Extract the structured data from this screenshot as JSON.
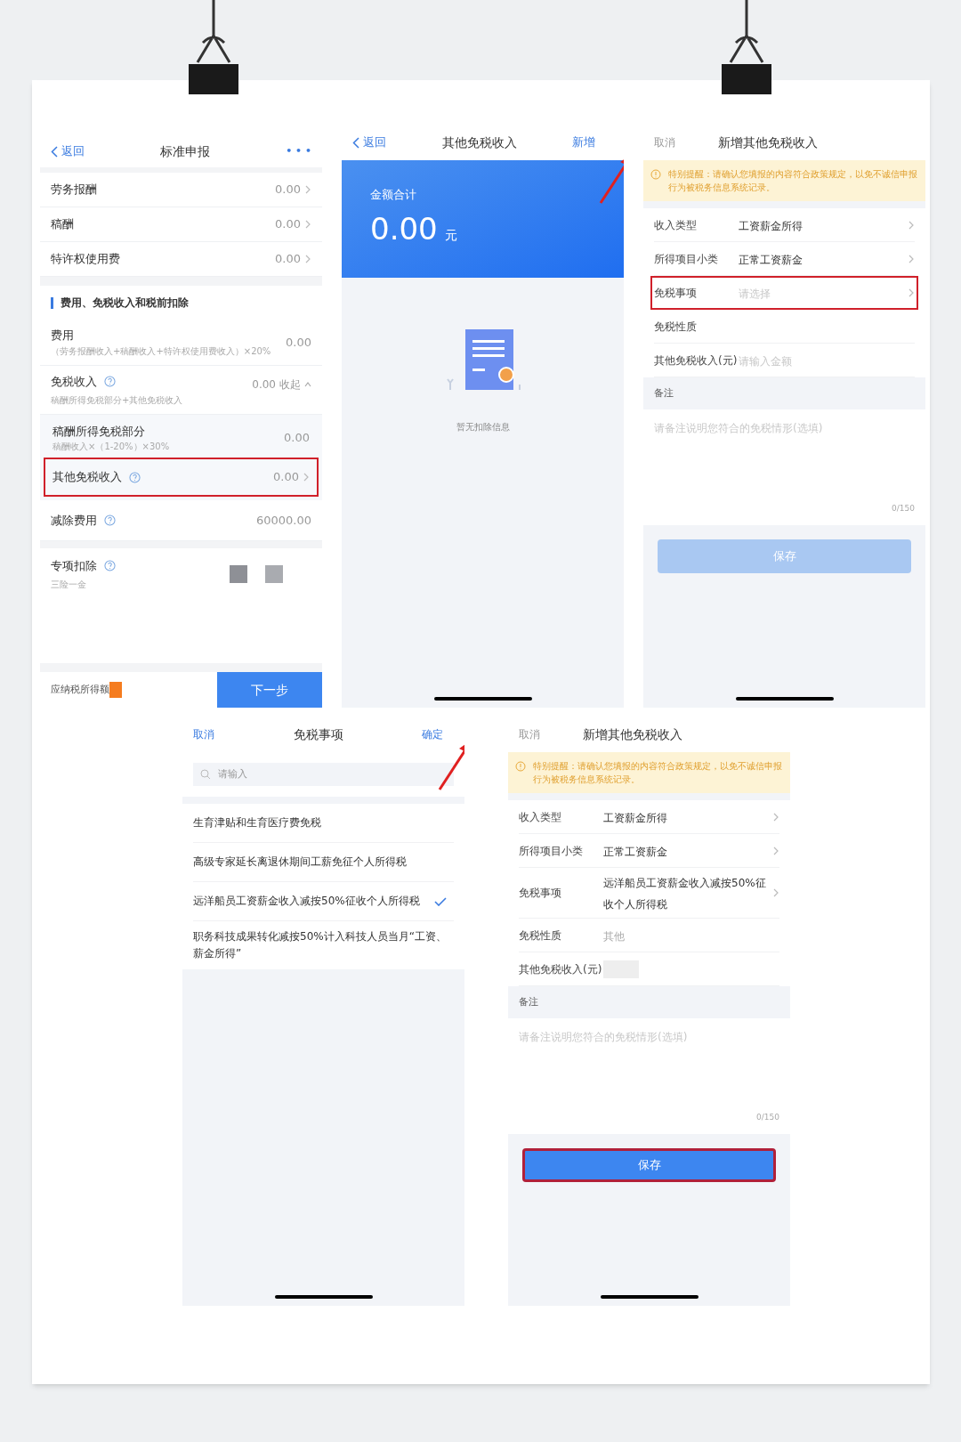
{
  "rows": [
    {
      "screens": [
        {
          "kind": "declaration",
          "nav": {
            "back": "返回",
            "title": "标准申报",
            "more": "• • •"
          },
          "income_rows": [
            {
              "label": "劳务报酬",
              "value": "0.00"
            },
            {
              "label": "稿酬",
              "value": "0.00"
            },
            {
              "label": "特许权使用费",
              "value": "0.00"
            }
          ],
          "section_title": "费用、免税收入和税前扣除",
          "expense": {
            "label": "费用",
            "note": "（劳务报酬收入+稿酬收入+特许权使用费收入）×20%",
            "value": "0.00"
          },
          "exempt": {
            "label": "免税收入",
            "note": "稿酬所得免税部分+其他免税收入",
            "value": "0.00",
            "toggle": "收起",
            "expanded": true
          },
          "sub_rows": [
            {
              "label": "稿酬所得免税部分",
              "note": "稿酬收入×（1-20%）×30%",
              "value": "0.00",
              "chevron": false,
              "highlighted": false
            },
            {
              "label": "其他免税收入",
              "value": "0.00",
              "chevron": true,
              "highlighted": true
            }
          ],
          "deduction": {
            "label": "减除费用",
            "value": "60000.00"
          },
          "special": {
            "label": "专项扣除",
            "note": "三险一金"
          },
          "footer": {
            "label": "应纳税所得额",
            "button": "下一步"
          }
        },
        {
          "kind": "summary",
          "nav": {
            "back": "返回",
            "title": "其他免税收入",
            "action": "新增",
            "annotated": true
          },
          "total_label": "金额合计",
          "amount": "0.00",
          "unit": "元",
          "empty_text": "暂无扣除信息"
        },
        {
          "kind": "form",
          "nav": {
            "cancel": "取消",
            "title": "新增其他免税收入"
          },
          "notice": "特别提醒：请确认您填报的内容符合政策规定，以免不诚信申报行为被税务信息系统记录。",
          "fields": [
            {
              "label": "收入类型",
              "value": "工资薪金所得",
              "chevron": true,
              "highlighted": false
            },
            {
              "label": "所得项目小类",
              "value": "正常工资薪金",
              "chevron": true,
              "highlighted": false
            },
            {
              "label": "免税事项",
              "placeholder": "请选择",
              "chevron": true,
              "highlighted": true
            },
            {
              "label": "免税性质",
              "chevron": false,
              "highlighted": false
            },
            {
              "label": "其他免税收入(元)",
              "placeholder": "请输入金额",
              "chevron": false,
              "highlighted": false
            }
          ],
          "remark_label": "备注",
          "remark_placeholder": "请备注说明您符合的免税情形(选填)",
          "counter": "0/150",
          "save": {
            "label": "保存",
            "disabled": true,
            "highlighted": false
          }
        }
      ]
    },
    {
      "screens": [
        {
          "kind": "picker",
          "nav": {
            "cancel": "取消",
            "title": "免税事项",
            "confirm": "确定",
            "annotated": true
          },
          "search_placeholder": "请输入",
          "options": [
            {
              "label": "生育津贴和生育医疗费免税",
              "selected": false
            },
            {
              "label": "高级专家延长离退休期间工薪免征个人所得税",
              "selected": false
            },
            {
              "label": "远洋船员工资薪金收入减按50%征收个人所得税",
              "selected": true
            },
            {
              "label": "职务科技成果转化减按50%计入科技人员当月“工资、薪金所得”",
              "selected": false
            }
          ]
        },
        {
          "kind": "form",
          "nav": {
            "cancel": "取消",
            "title": "新增其他免税收入"
          },
          "notice": "特别提醒：请确认您填报的内容符合政策规定，以免不诚信申报行为被税务信息系统记录。",
          "fields": [
            {
              "label": "收入类型",
              "value": "工资薪金所得",
              "chevron": true,
              "highlighted": false
            },
            {
              "label": "所得项目小类",
              "value": "正常工资薪金",
              "chevron": true,
              "highlighted": false
            },
            {
              "label": "免税事项",
              "value": "远洋船员工资薪金收入减按50%征收个人所得税",
              "chevron": true,
              "highlighted": false
            },
            {
              "label": "免税性质",
              "value": "其他",
              "muted": true,
              "chevron": false,
              "highlighted": false
            },
            {
              "label": "其他免税收入(元)",
              "masked": true,
              "chevron": false,
              "highlighted": false
            }
          ],
          "remark_label": "备注",
          "remark_placeholder": "请备注说明您符合的免税情形(选填)",
          "counter": "0/150",
          "save": {
            "label": "保存",
            "disabled": false,
            "highlighted": true
          }
        }
      ]
    }
  ]
}
